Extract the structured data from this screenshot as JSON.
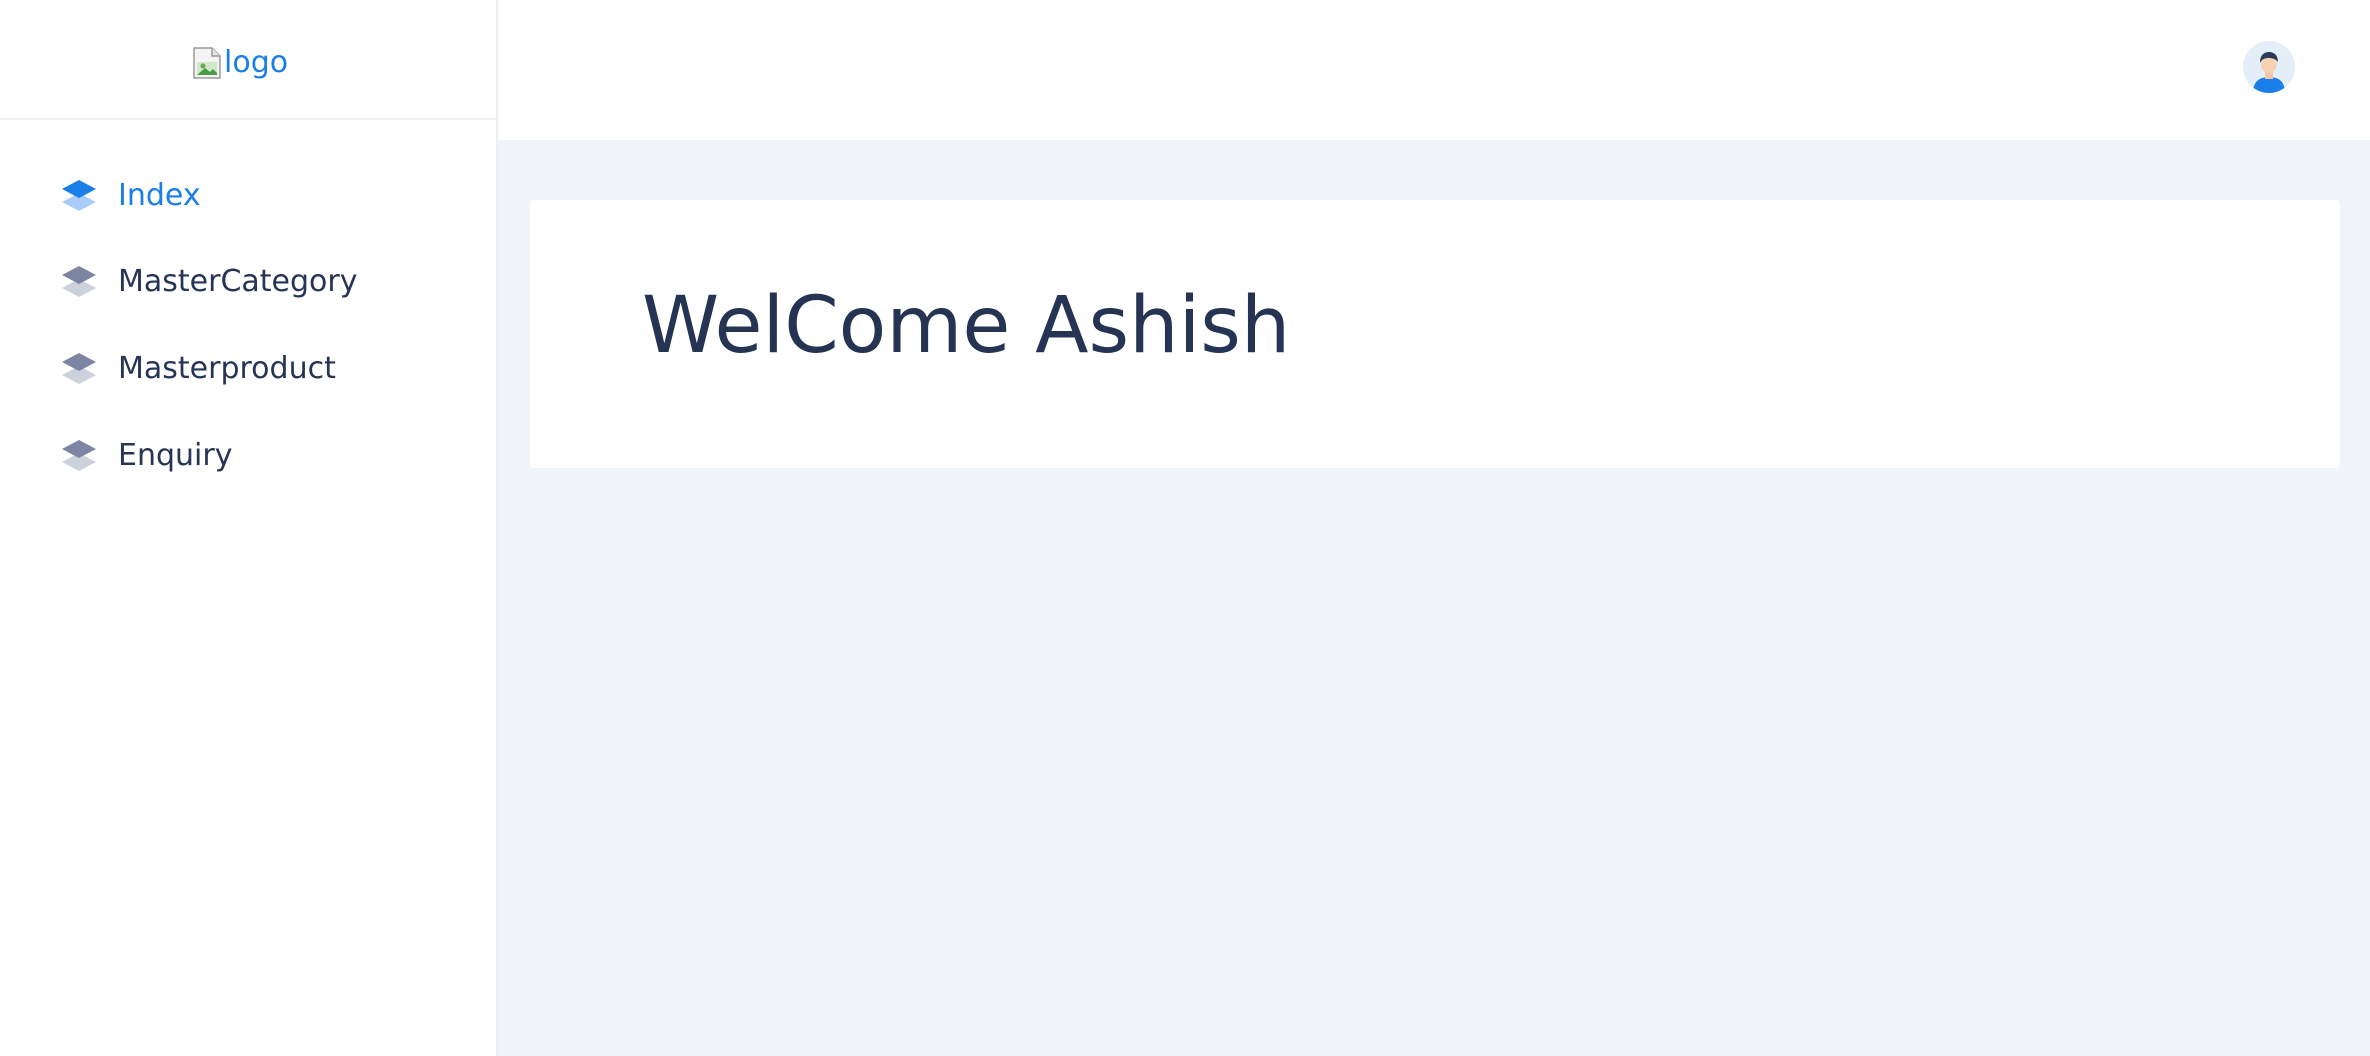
{
  "sidebar": {
    "logo_text": "logo",
    "items": [
      {
        "label": "Index",
        "active": true
      },
      {
        "label": "MasterCategory",
        "active": false
      },
      {
        "label": "Masterproduct",
        "active": false
      },
      {
        "label": "Enquiry",
        "active": false
      }
    ]
  },
  "header": {
    "avatar_icon": "user-avatar-icon"
  },
  "main": {
    "welcome_text": "WelCome Ashish"
  },
  "colors": {
    "accent": "#1a7fe8",
    "text": "#263555",
    "icon_inactive": "#7c86a2",
    "background": "#f1f4f9"
  }
}
